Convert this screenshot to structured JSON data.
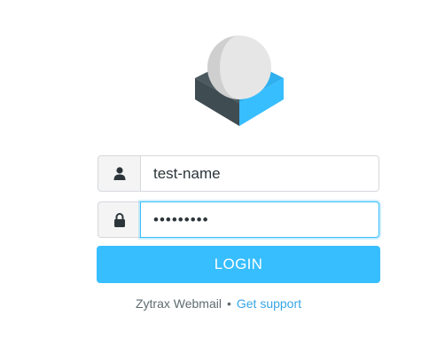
{
  "login": {
    "username_value": "test-name",
    "password_value": "•••••••••",
    "button_label": "LOGIN"
  },
  "footer": {
    "product_name": "Zytrax Webmail",
    "separator": "•",
    "support_link": "Get support"
  },
  "icons": {
    "logo": "roundcube-logo",
    "username": "user-icon",
    "password": "lock-icon"
  },
  "colors": {
    "accent": "#37beff",
    "logo_dark": "#3f4c52",
    "logo_sphere": "#dcdcdc",
    "link": "#37a6e6"
  }
}
